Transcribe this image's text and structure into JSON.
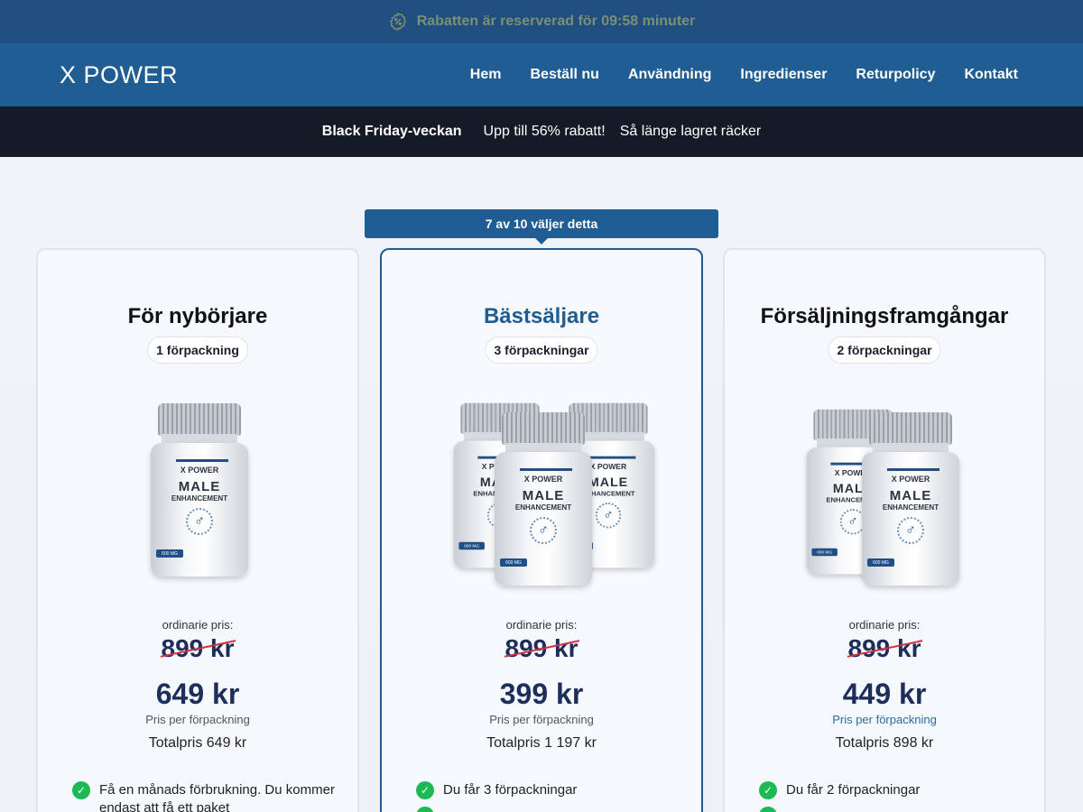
{
  "topbar": {
    "text": "Rabatten är reserverad för 09:58 minuter",
    "icon": "discount-badge-icon",
    "color": "#7d8f73"
  },
  "nav": {
    "logo": "X POWER",
    "items": [
      "Hem",
      "Beställ nu",
      "Användning",
      "Ingredienser",
      "Returpolicy",
      "Kontakt"
    ]
  },
  "promo": {
    "a": "Black Friday-veckan",
    "b": "Upp till 56% rabatt!",
    "c": "Så länge lagret räcker"
  },
  "ribbon": "7 av 10 väljer detta",
  "bottle": {
    "brand": "X POWER",
    "line1": "MALE",
    "line2": "ENHANCEMENT",
    "symbol": "♂",
    "dose": "600 MG"
  },
  "cards": [
    {
      "title": "För nybörjare",
      "pack": "1 förpackning",
      "ord_label": "ordinarie pris:",
      "old_price": "899 kr",
      "price": "649 kr",
      "per": "Pris per förpackning",
      "total": "Totalpris 649 kr",
      "features": [
        "Få en månads förbrukning. Du kommer endast att få ett paket"
      ]
    },
    {
      "title": "Bästsäljare",
      "pack": "3 förpackningar",
      "ord_label": "ordinarie pris:",
      "old_price": "899 kr",
      "price": "399 kr",
      "per": "Pris per förpackning",
      "total": "Totalpris 1 197 kr",
      "features": [
        "Du får 3 förpackningar",
        ""
      ]
    },
    {
      "title": "Försäljningsframgångar",
      "pack": "2 förpackningar",
      "ord_label": "ordinarie pris:",
      "old_price": "899 kr",
      "price": "449 kr",
      "per": "Pris per förpackning",
      "total": "Totalpris 898 kr",
      "features": [
        "Du får 2 förpackningar",
        ""
      ]
    }
  ],
  "colors": {
    "accent": "#1f5d92",
    "dark": "#141a26",
    "price": "#1e2e5a",
    "check": "#1db954",
    "strike": "#d23242"
  }
}
